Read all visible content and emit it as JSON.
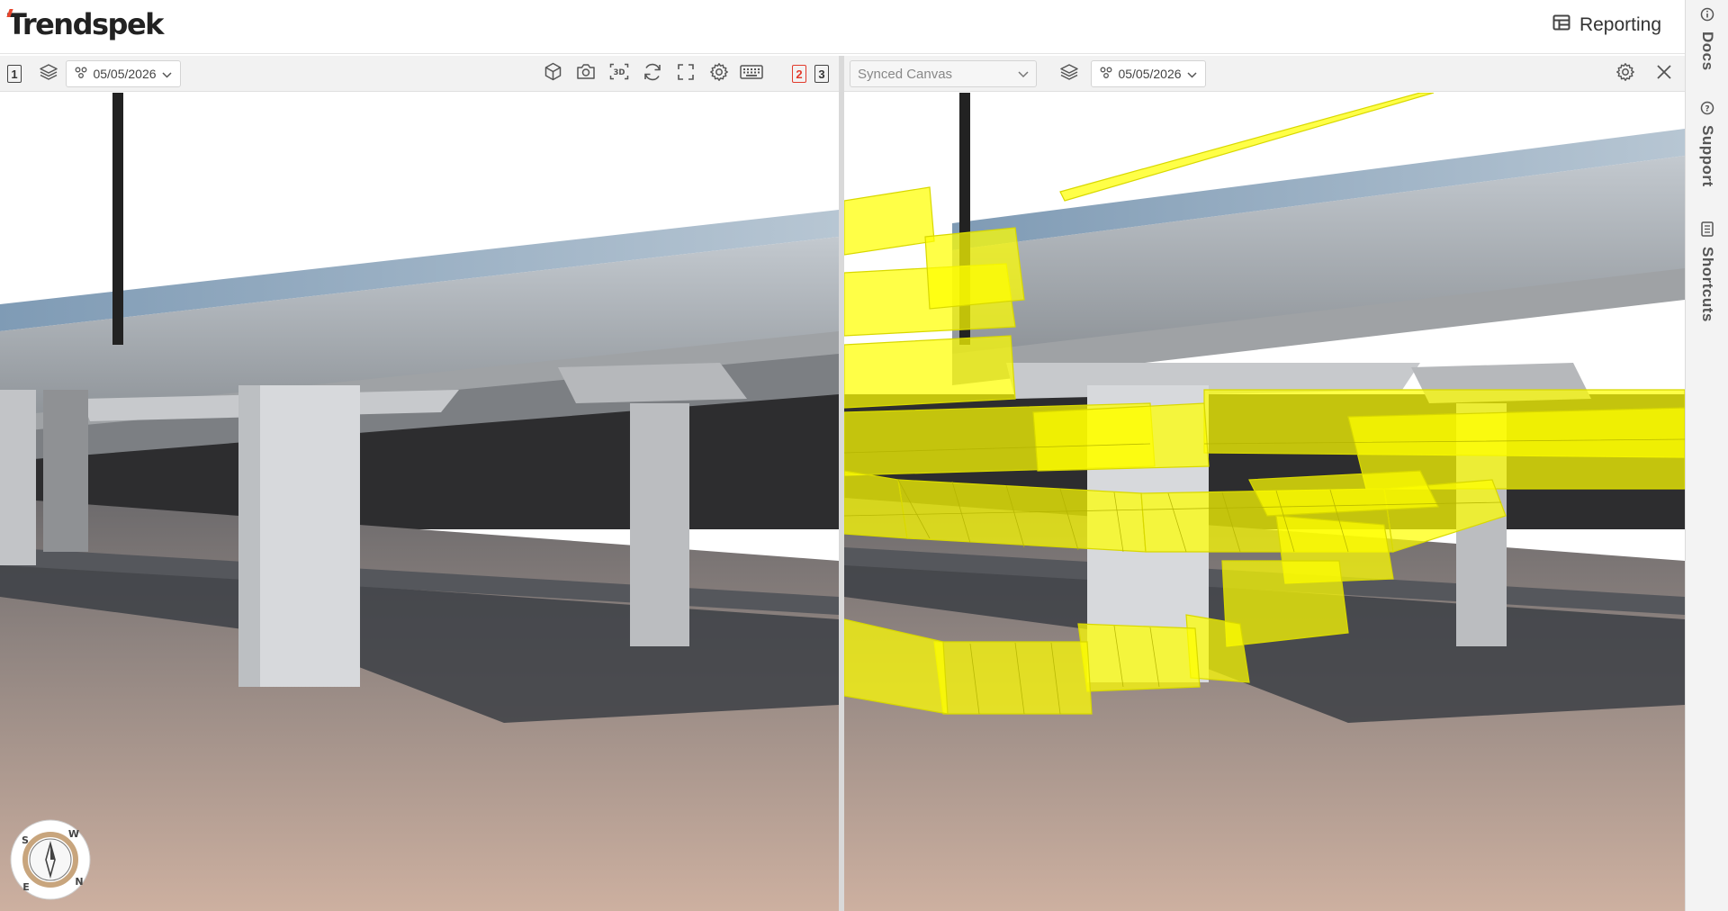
{
  "header": {
    "brand": "Trendspek",
    "reporting_label": "Reporting"
  },
  "rail": {
    "items": [
      {
        "label": "Docs",
        "icon": "info-icon"
      },
      {
        "label": "Support",
        "icon": "help-icon"
      },
      {
        "label": "Shortcuts",
        "icon": "document-icon"
      }
    ]
  },
  "left_viewport": {
    "viewport_number": "1",
    "date": "05/05/2026",
    "split_options": [
      "2",
      "3"
    ],
    "active_split": "2",
    "compass": {
      "n": "N",
      "e": "E",
      "s": "S",
      "w": "W"
    }
  },
  "right_viewport": {
    "sync_select_value": "Synced Canvas",
    "date": "05/05/2026"
  },
  "colors": {
    "accent": "#e23b2c",
    "overlay_yellow": "#ffff00",
    "sky": "#ffffff",
    "ground_shadow": "#3b3e44",
    "ground_light": "#c8a996"
  }
}
